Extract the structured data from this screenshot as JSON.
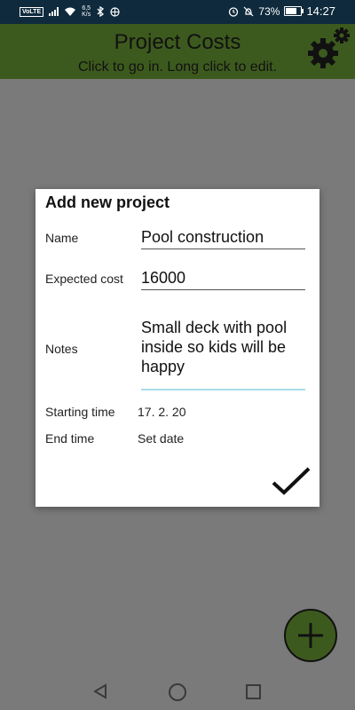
{
  "status_bar": {
    "network_badge": "VoLTE",
    "data_speed_top": "6,5",
    "data_speed_bottom": "K/s",
    "battery_percent": "73%",
    "battery_level": 0.73,
    "time": "14:27"
  },
  "app_bar": {
    "title": "Project Costs",
    "subtitle": "Click to go in. Long click to edit.",
    "accent_color": "#3d5a1e",
    "settings_icon": "gear-icon"
  },
  "dialog": {
    "title": "Add new project",
    "fields": {
      "name_label": "Name",
      "name_value": "Pool construction",
      "cost_label": "Expected cost",
      "cost_value": "16000",
      "notes_label": "Notes",
      "notes_value": "Small deck with pool inside so kids will be happy",
      "start_label": "Starting time",
      "start_value": "17. 2. 20",
      "end_label": "End time",
      "end_value": "Set date"
    },
    "confirm_icon": "checkmark-icon"
  },
  "fab": {
    "icon": "plus-icon"
  },
  "nav": {
    "back_icon": "back-triangle-icon",
    "home_icon": "home-circle-icon",
    "recent_icon": "recents-square-icon"
  }
}
